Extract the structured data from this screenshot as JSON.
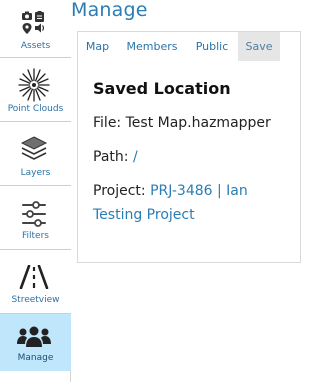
{
  "sidebar": {
    "items": [
      {
        "key": "assets",
        "label": "Assets",
        "icon": "assets-icon",
        "active": false
      },
      {
        "key": "point-clouds",
        "label": "Point Clouds",
        "icon": "point-cloud-icon",
        "active": false
      },
      {
        "key": "layers",
        "label": "Layers",
        "icon": "layers-icon",
        "active": false
      },
      {
        "key": "filters",
        "label": "Filters",
        "icon": "sliders-icon",
        "active": false
      },
      {
        "key": "streetview",
        "label": "Streetview",
        "icon": "road-icon",
        "active": false
      },
      {
        "key": "manage",
        "label": "Manage",
        "icon": "users-icon",
        "active": true
      }
    ]
  },
  "header": {
    "title": "Manage"
  },
  "tabs": [
    {
      "label": "Map",
      "active": false
    },
    {
      "label": "Members",
      "active": false
    },
    {
      "label": "Public",
      "active": false
    },
    {
      "label": "Save",
      "active": true
    }
  ],
  "saved_location": {
    "title": "Saved Location",
    "file_label": "File:",
    "file_value": "Test Map.hazmapper",
    "path_label": "Path:",
    "path_value": "/",
    "project_label": "Project:",
    "project_value": "PRJ-3486 | Ian Testing Project"
  },
  "colors": {
    "accent": "#2a7db5",
    "active_nav_bg": "#bfe6fb",
    "active_tab_bg": "#e6e6e6"
  }
}
